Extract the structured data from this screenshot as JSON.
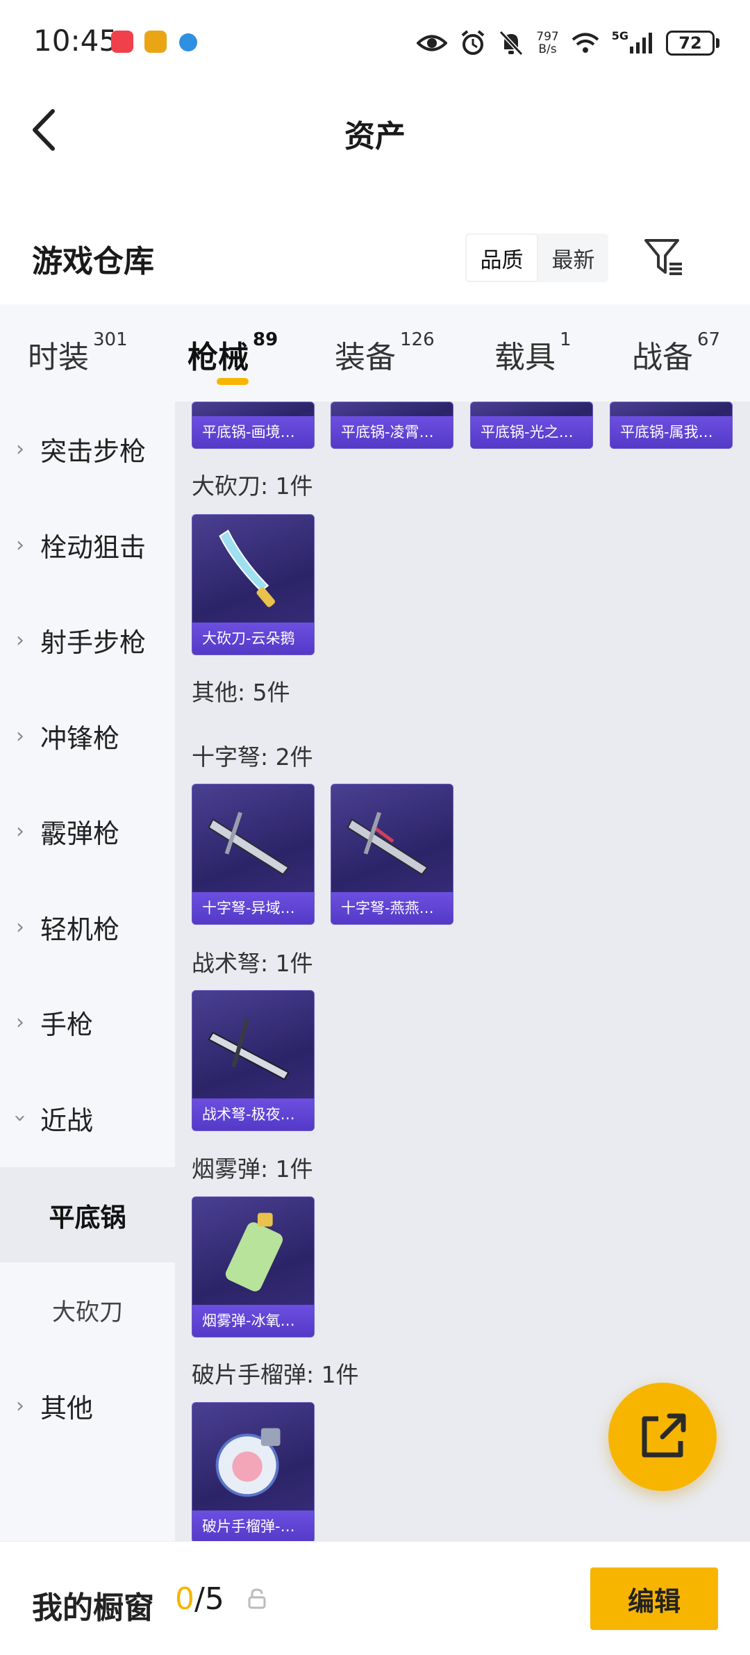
{
  "status_bar": {
    "time": "10:45",
    "net_speed_value": "797",
    "net_speed_unit": "B/s",
    "network_type": "5G",
    "battery": "72"
  },
  "header": {
    "title": "资产",
    "back_icon": "chevron-left-icon"
  },
  "section": {
    "title": "游戏仓库",
    "sort_options": [
      "品质",
      "最新"
    ],
    "sort_active": "品质",
    "filter_icon": "filter-icon"
  },
  "tabs": [
    {
      "label": "时装",
      "count": "301"
    },
    {
      "label": "枪械",
      "count": "89"
    },
    {
      "label": "装备",
      "count": "126"
    },
    {
      "label": "载具",
      "count": "1"
    },
    {
      "label": "战备",
      "count": "67"
    }
  ],
  "active_tab": "枪械",
  "sidebar": {
    "items": [
      {
        "label": "突击步枪",
        "expanded": false
      },
      {
        "label": "栓动狙击",
        "expanded": false
      },
      {
        "label": "射手步枪",
        "expanded": false
      },
      {
        "label": "冲锋枪",
        "expanded": false
      },
      {
        "label": "霰弹枪",
        "expanded": false
      },
      {
        "label": "轻机枪",
        "expanded": false
      },
      {
        "label": "手枪",
        "expanded": false
      },
      {
        "label": "近战",
        "expanded": true
      },
      {
        "label": "平底锅",
        "sub": true,
        "selected": true
      },
      {
        "label": "大砍刀",
        "sub": true,
        "selected": false
      },
      {
        "label": "其他",
        "expanded": false
      }
    ]
  },
  "content": {
    "top_cards": [
      "平底锅-画境…",
      "平底锅-凌霄…",
      "平底锅-光之…",
      "平底锅-属我…"
    ],
    "groups": [
      {
        "label": "大砍刀: 1件",
        "cards": [
          "大砍刀-云朵鹅"
        ]
      },
      {
        "label": "其他: 5件",
        "cards": []
      },
      {
        "label": "十字弩: 2件",
        "cards": [
          "十字弩-异域…",
          "十字弩-燕燕…"
        ]
      },
      {
        "label": "战术弩: 1件",
        "cards": [
          "战术弩-极夜…"
        ]
      },
      {
        "label": "烟雾弹: 1件",
        "cards": [
          "烟雾弹-冰氧…"
        ]
      },
      {
        "label": "破片手榴弹: 1件",
        "cards": [
          "破片手榴弹-…"
        ]
      }
    ]
  },
  "fab_icon": "share-external-icon",
  "bottom_bar": {
    "label": "我的橱窗",
    "used": "0",
    "total": "/5",
    "lock_icon": "lock-icon",
    "edit_label": "编辑"
  },
  "colors": {
    "accent": "#f7b500",
    "card_bg": "#2c2468",
    "card_band": "#5b3fd0",
    "content_bg": "#e9ebf0",
    "sidebar_bg": "#f5f7fa"
  }
}
